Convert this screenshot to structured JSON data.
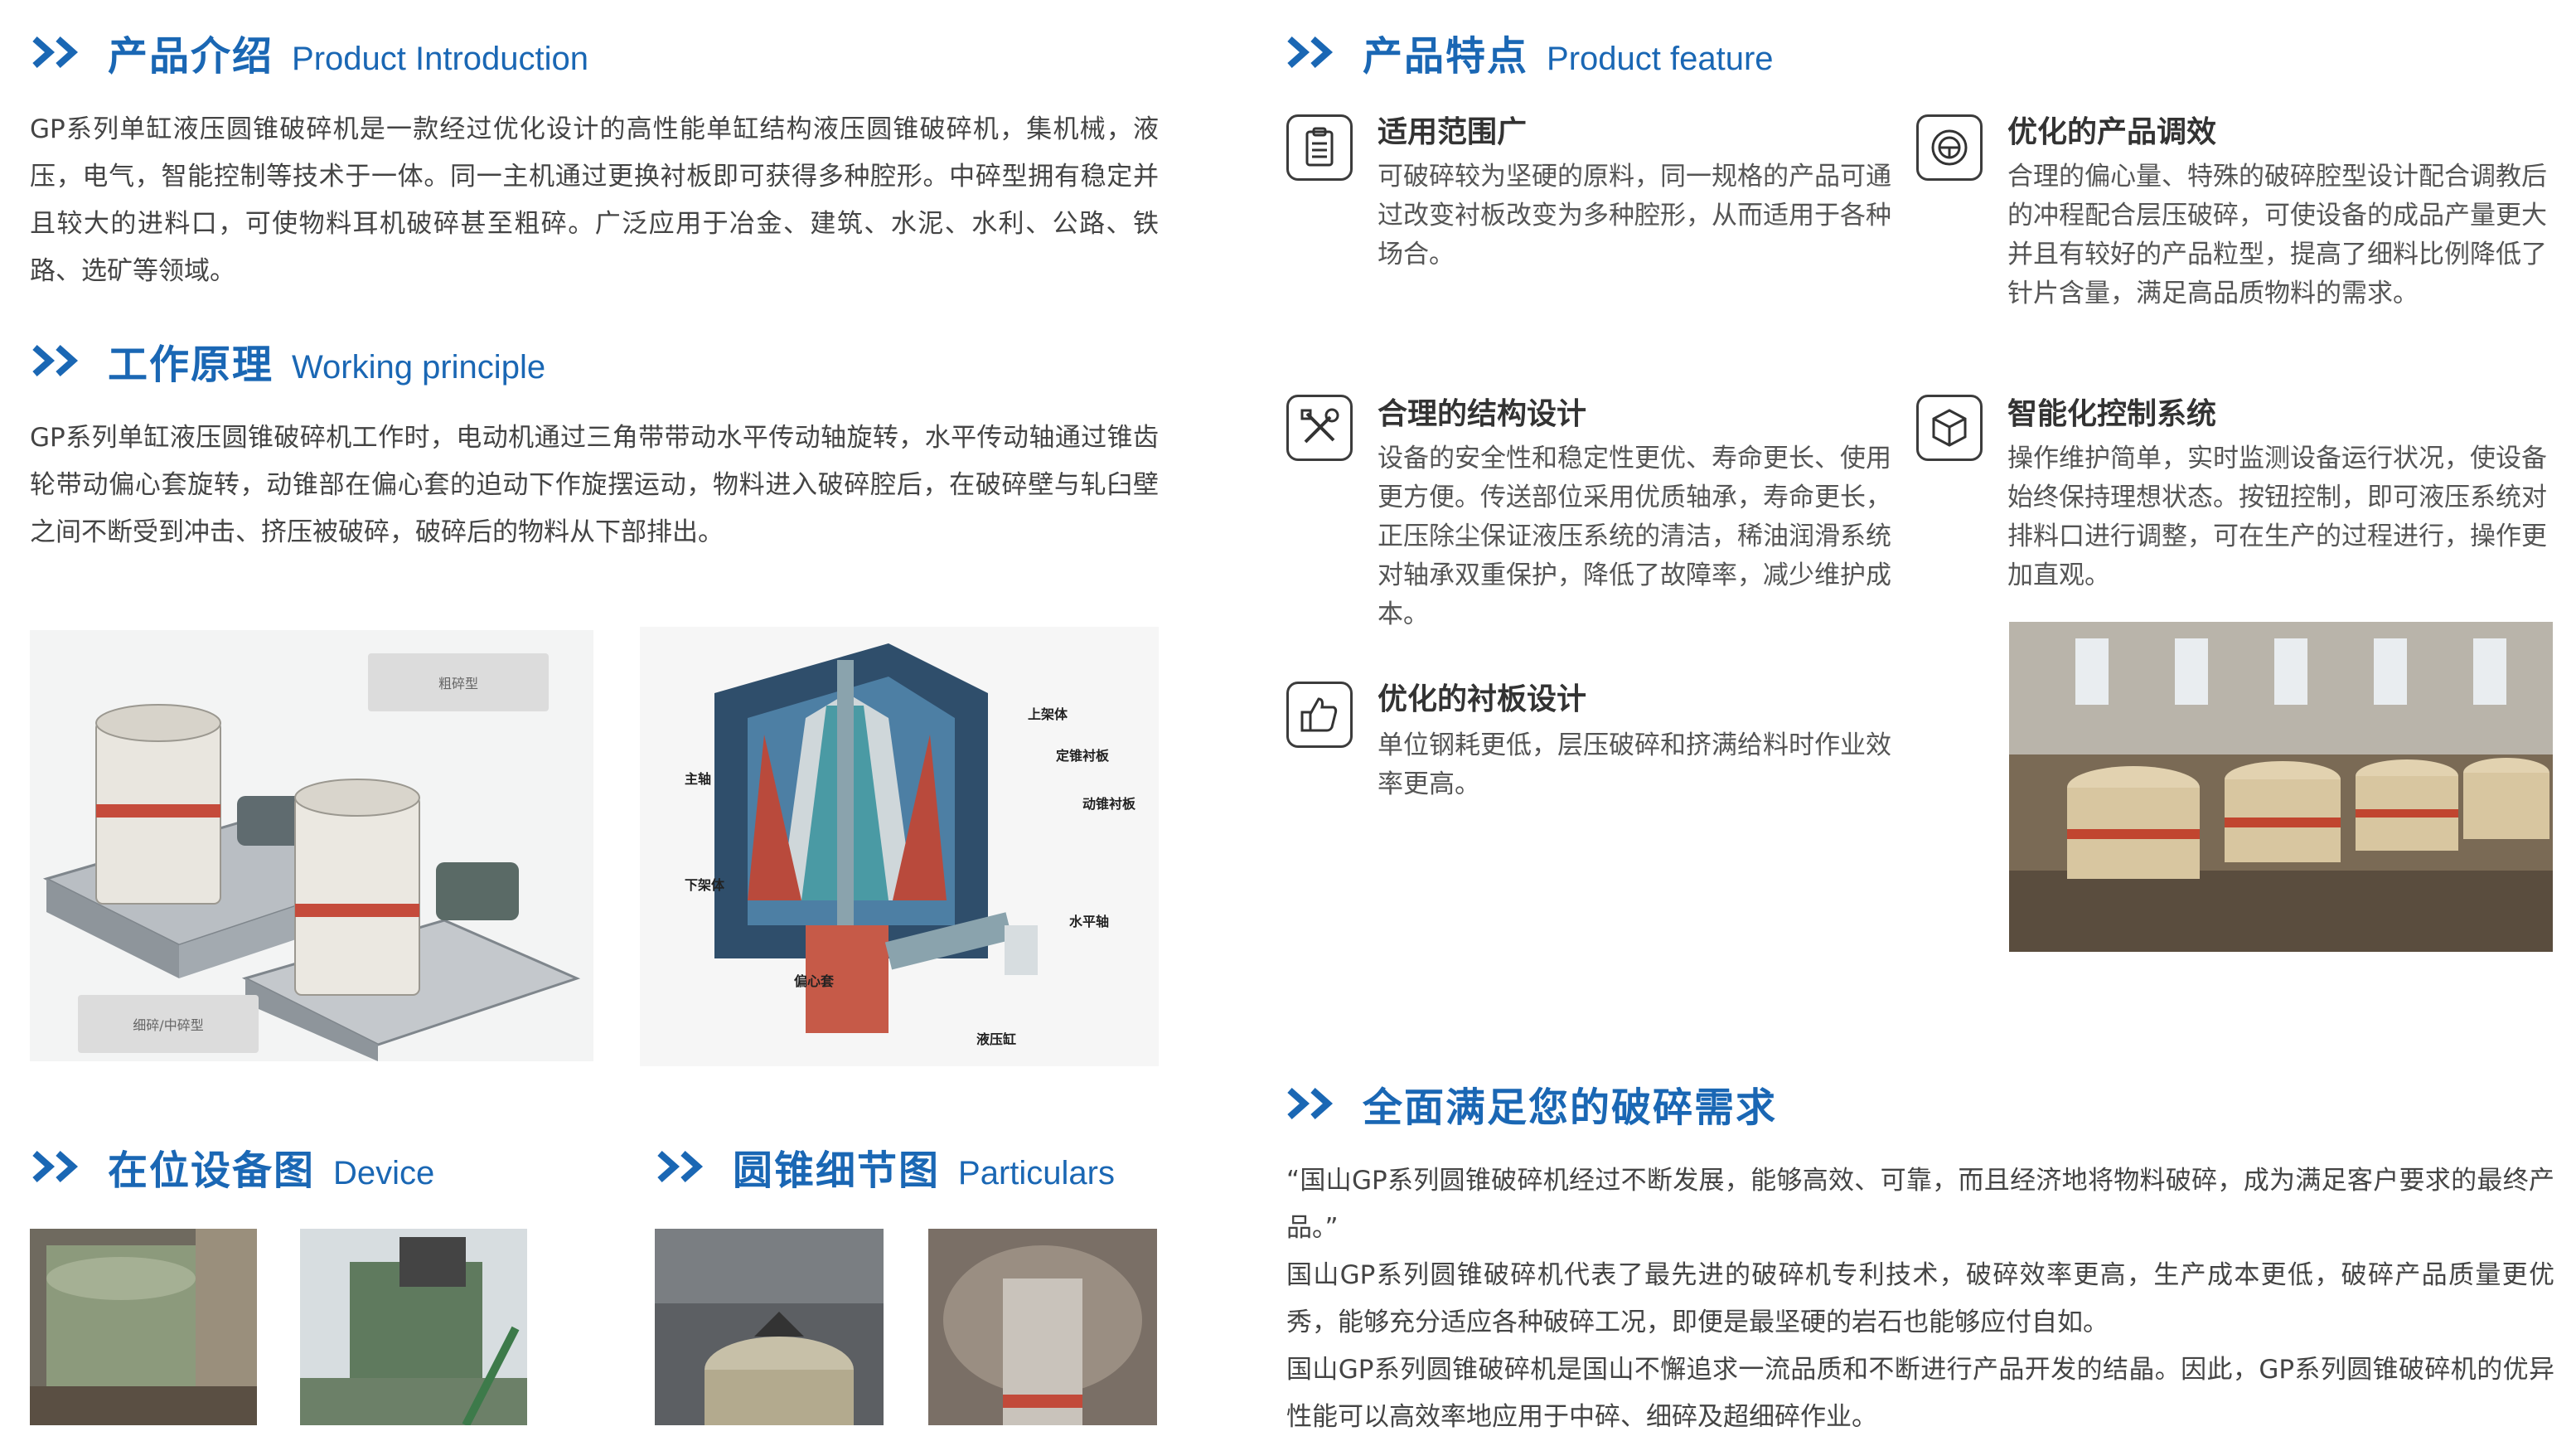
{
  "colors": {
    "accent": "#1a67b4",
    "body_text": "#444444"
  },
  "intro": {
    "title_cn": "产品介绍",
    "title_en": "Product Introduction",
    "text": "GP系列单缸液压圆锥破碎机是一款经过优化设计的高性能单缸结构液压圆锥破碎机，集机械，液压，电气，智能控制等技术于一体。同一主机通过更换衬板即可获得多种腔形。中碎型拥有稳定并且较大的进料口，可使物料耳机破碎甚至粗碎。广泛应用于冶金、建筑、水泥、水利、公路、铁路、选矿等领域。"
  },
  "principle": {
    "title_cn": "工作原理",
    "title_en": "Working principle",
    "text": "GP系列单缸液压圆锥破碎机工作时，电动机通过三角带带动水平传动轴旋转，水平传动轴通过锥齿轮带动偏心套旋转，动锥部在偏心套的迫动下作旋摆运动，物料进入破碎腔后，在破碎壁与轧臼壁之间不断受到冲击、挤压被破碎，破碎后的物料从下部排出。"
  },
  "machine_tags": {
    "coarse": "粗碎型",
    "fine_medium": "细碎/中碎型"
  },
  "cross_section_labels": {
    "upper_frame": "上架体",
    "fixed_liner": "定锥衬板",
    "main_shaft": "主轴",
    "moving_liner": "动锥衬板",
    "lower_frame": "下架体",
    "horizontal_shaft": "水平轴",
    "eccentric": "偏心套",
    "hydraulic_cylinder": "液压缸"
  },
  "device": {
    "title_cn": "在位设备图",
    "title_en": "Device"
  },
  "particulars": {
    "title_cn": "圆锥细节图",
    "title_en": "Particulars"
  },
  "features": {
    "title_cn": "产品特点",
    "title_en": "Product feature",
    "items": [
      {
        "icon": "clipboard-icon",
        "title": "适用范围广",
        "text": "可破碎较为坚硬的原料，同一规格的产品可通过改变衬板改变为多种腔形，从而适用于各种场合。"
      },
      {
        "icon": "steering-wheel-icon",
        "title": "优化的产品调效",
        "text": "合理的偏心量、特殊的破碎腔型设计配合调教后的冲程配合层压破碎，可使设备的成品产量更大并且有较好的产品粒型，提高了细料比例降低了针片含量，满足高品质物料的需求。"
      },
      {
        "icon": "tools-icon",
        "title": "合理的结构设计",
        "text": "设备的安全性和稳定性更优、寿命更长、使用更方便。传送部位采用优质轴承，寿命更长，正压除尘保证液压系统的清洁，稀油润滑系统对轴承双重保护，降低了故障率，减少维护成本。"
      },
      {
        "icon": "cube-icon",
        "title": "智能化控制系统",
        "text": "操作维护简单，实时监测设备运行状况，使设备始终保持理想状态。按钮控制，即可液压系统对排料口进行调整，可在生产的过程进行，操作更加直观。"
      },
      {
        "icon": "thumbs-up-icon",
        "title": "优化的衬板设计",
        "text": "单位钢耗更低，层压破碎和挤满给料时作业效率更高。"
      }
    ]
  },
  "needs": {
    "title_cn": "全面满足您的破碎需求",
    "paragraphs": [
      "“国山GP系列圆锥破碎机经过不断发展，能够高效、可靠，而且经济地将物料破碎，成为满足客户要求的最终产品。”",
      "国山GP系列圆锥破碎机代表了最先进的破碎机专利技术，破碎效率更高，生产成本更低，破碎产品质量更优秀，能够充分适应各种破碎工况，即便是最坚硬的岩石也能够应付自如。",
      "国山GP系列圆锥破碎机是国山不懈追求一流品质和不断进行产品开发的结晶。因此，GP系列圆锥破碎机的优异性能可以高效率地应用于中碎、细碎及超细碎作业。"
    ]
  }
}
